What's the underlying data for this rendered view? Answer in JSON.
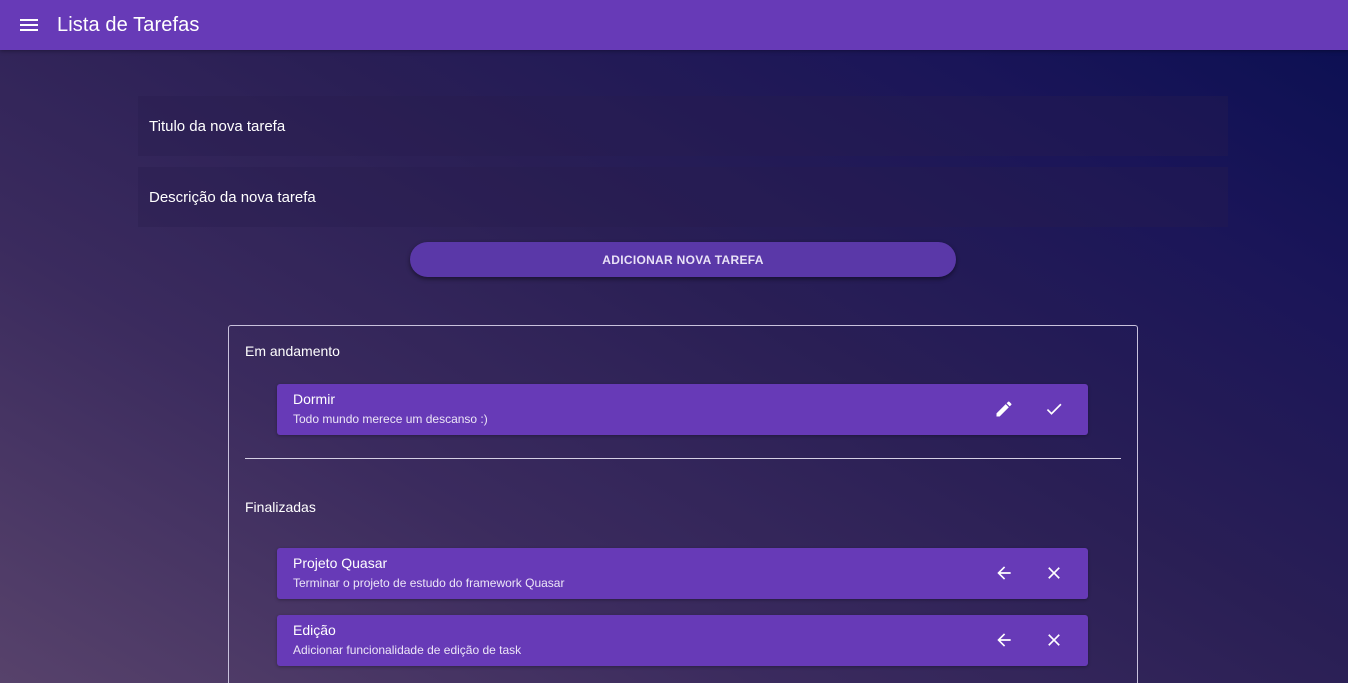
{
  "header": {
    "menu_icon": "menu-icon",
    "title": "Lista de Tarefas",
    "color": "#673ab7"
  },
  "form": {
    "title_placeholder": "Titulo da nova tarefa",
    "description_placeholder": "Descrição da nova tarefa",
    "add_button_label": "ADICIONAR NOVA TAREFA"
  },
  "sections": {
    "in_progress": {
      "label": "Em andamento",
      "tasks": [
        {
          "title": "Dormir",
          "description": "Todo mundo merece um descanso :)",
          "actions": [
            "edit-icon",
            "check-icon"
          ]
        }
      ]
    },
    "finished": {
      "label": "Finalizadas",
      "tasks": [
        {
          "title": "Projeto Quasar",
          "description": "Terminar o projeto de estudo do framework Quasar",
          "actions": [
            "arrow-back-icon",
            "close-icon"
          ]
        },
        {
          "title": "Edição",
          "description": "Adicionar funcionalidade de edição de task",
          "actions": [
            "arrow-back-icon",
            "close-icon"
          ]
        }
      ]
    }
  },
  "colors": {
    "primary": "#673ab7",
    "background_dark": "#0a0f52",
    "background_light": "#57426b"
  }
}
